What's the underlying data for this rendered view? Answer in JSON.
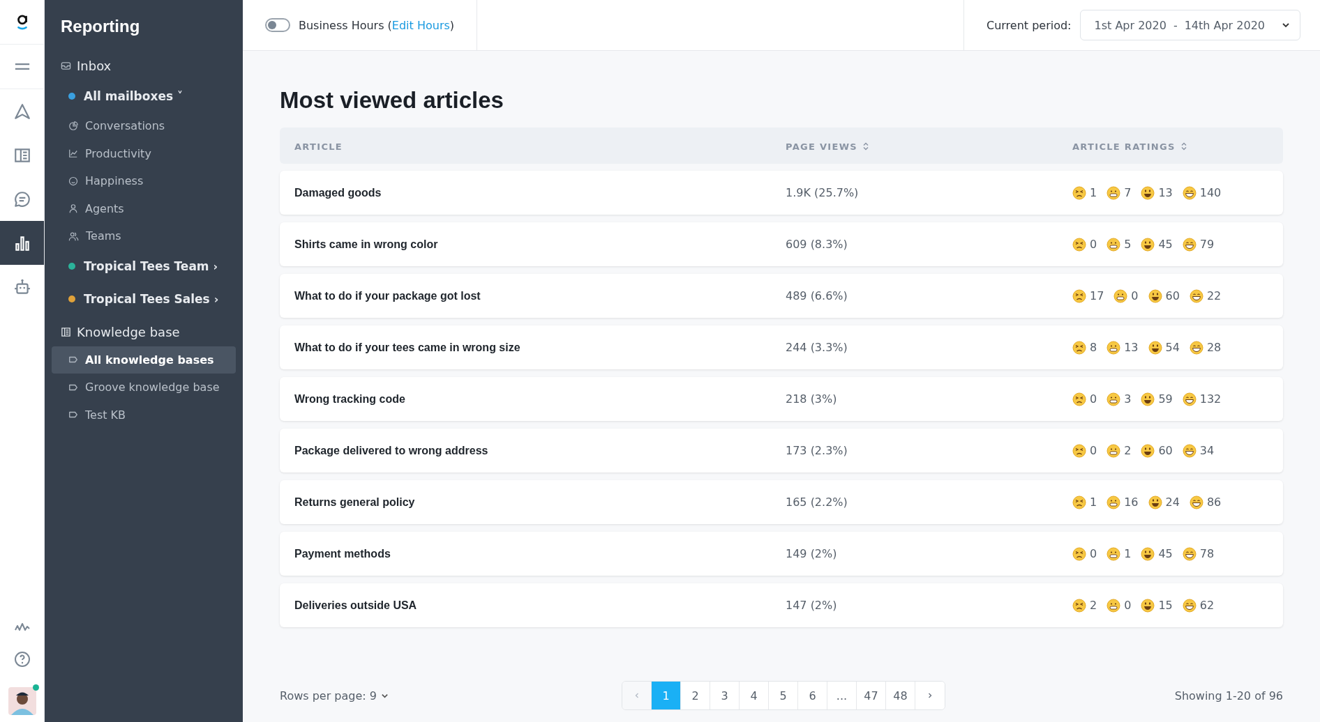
{
  "rail": {
    "items": [
      {
        "kind": "menu",
        "selected": false
      },
      {
        "kind": "send",
        "selected": false
      },
      {
        "kind": "book",
        "selected": false
      },
      {
        "kind": "chat",
        "selected": false
      },
      {
        "kind": "chart",
        "selected": true
      },
      {
        "kind": "bot",
        "selected": false
      }
    ],
    "bottom": [
      {
        "kind": "pulse"
      },
      {
        "kind": "help"
      }
    ],
    "avatar_online": true
  },
  "sidebar": {
    "title": "Reporting",
    "sections": [
      {
        "label": "Inbox",
        "kind": "inbox",
        "items": [
          {
            "label": "All mailboxes",
            "kind": "group",
            "color": "#3aa0e0",
            "caret": "˅",
            "selected": false
          },
          {
            "label": "Conversations",
            "kind": "pie",
            "selected": false
          },
          {
            "label": "Productivity",
            "kind": "line",
            "selected": false
          },
          {
            "label": "Happiness",
            "kind": "smile",
            "selected": false
          },
          {
            "label": "Agents",
            "kind": "person",
            "selected": false
          },
          {
            "label": "Teams",
            "kind": "people",
            "selected": false
          },
          {
            "label": "Tropical Tees Team",
            "kind": "group",
            "color": "#2bb39a",
            "caret": "›",
            "selected": false
          },
          {
            "label": "Tropical Tees Sales",
            "kind": "group",
            "color": "#e0a23a",
            "caret": "›",
            "selected": false
          }
        ]
      },
      {
        "label": "Knowledge base",
        "kind": "book",
        "items": [
          {
            "label": "All knowledge bases",
            "kind": "tag",
            "selected": true
          },
          {
            "label": "Groove knowledge base",
            "kind": "tag",
            "selected": false
          },
          {
            "label": "Test KB",
            "kind": "tag",
            "selected": false
          }
        ]
      }
    ]
  },
  "topbar": {
    "business_hours": {
      "label": "Business Hours (",
      "link": "Edit Hours",
      "suffix": ")",
      "on": false
    },
    "period_label": "Current period:",
    "period_start": "1st Apr 2020",
    "period_sep": "-",
    "period_end": "14th Apr 2020"
  },
  "title": "Most viewed articles",
  "table": {
    "columns": [
      {
        "label": "ARTICLE",
        "sortable": false
      },
      {
        "label": "PAGE VIEWS",
        "sortable": true
      },
      {
        "label": "ARTICLE RATINGS",
        "sortable": true
      }
    ],
    "rows": [
      {
        "article": "Damaged goods",
        "views": "1.9K (25.7%)",
        "ratings": [
          {
            "kind": "tired",
            "count": "1"
          },
          {
            "kind": "grimace",
            "count": "7"
          },
          {
            "kind": "smile",
            "count": "13"
          },
          {
            "kind": "grin",
            "count": "140"
          }
        ]
      },
      {
        "article": "Shirts came in wrong color",
        "views": "609 (8.3%)",
        "ratings": [
          {
            "kind": "tired",
            "count": "0"
          },
          {
            "kind": "grimace",
            "count": "5"
          },
          {
            "kind": "smile",
            "count": "45"
          },
          {
            "kind": "grin",
            "count": "79"
          }
        ]
      },
      {
        "article": "What to do if your package got lost",
        "views": "489 (6.6%)",
        "ratings": [
          {
            "kind": "tired",
            "count": "17"
          },
          {
            "kind": "grimace",
            "count": "0"
          },
          {
            "kind": "smile",
            "count": "60"
          },
          {
            "kind": "grin",
            "count": "22"
          }
        ]
      },
      {
        "article": "What to do if your tees came in wrong size",
        "views": "244 (3.3%)",
        "ratings": [
          {
            "kind": "tired",
            "count": "8"
          },
          {
            "kind": "grimace",
            "count": "13"
          },
          {
            "kind": "smile",
            "count": "54"
          },
          {
            "kind": "grin",
            "count": "28"
          }
        ]
      },
      {
        "article": "Wrong tracking code",
        "views": "218 (3%)",
        "ratings": [
          {
            "kind": "tired",
            "count": "0"
          },
          {
            "kind": "grimace",
            "count": "3"
          },
          {
            "kind": "smile",
            "count": "59"
          },
          {
            "kind": "grin",
            "count": "132"
          }
        ]
      },
      {
        "article": "Package delivered to wrong address",
        "views": "173 (2.3%)",
        "ratings": [
          {
            "kind": "tired",
            "count": "0"
          },
          {
            "kind": "grimace",
            "count": "2"
          },
          {
            "kind": "smile",
            "count": "60"
          },
          {
            "kind": "grin",
            "count": "34"
          }
        ]
      },
      {
        "article": "Returns general policy",
        "views": "165 (2.2%)",
        "ratings": [
          {
            "kind": "tired",
            "count": "1"
          },
          {
            "kind": "grimace",
            "count": "16"
          },
          {
            "kind": "smile",
            "count": "24"
          },
          {
            "kind": "grin",
            "count": "86"
          }
        ]
      },
      {
        "article": "Payment methods",
        "views": "149 (2%)",
        "ratings": [
          {
            "kind": "tired",
            "count": "0"
          },
          {
            "kind": "grimace",
            "count": "1"
          },
          {
            "kind": "smile",
            "count": "45"
          },
          {
            "kind": "grin",
            "count": "78"
          }
        ]
      },
      {
        "article": "Deliveries outside USA",
        "views": "147 (2%)",
        "ratings": [
          {
            "kind": "tired",
            "count": "2"
          },
          {
            "kind": "grimace",
            "count": "0"
          },
          {
            "kind": "smile",
            "count": "15"
          },
          {
            "kind": "grin",
            "count": "62"
          }
        ]
      }
    ]
  },
  "footer": {
    "rows_per_page": "Rows per page: 9",
    "pages": [
      {
        "label": "1",
        "selected": true
      },
      {
        "label": "2",
        "selected": false
      },
      {
        "label": "3",
        "selected": false
      },
      {
        "label": "4",
        "selected": false
      },
      {
        "label": "5",
        "selected": false
      },
      {
        "label": "6",
        "selected": false
      },
      {
        "label": "...",
        "selected": false
      },
      {
        "label": "47",
        "selected": false
      },
      {
        "label": "48",
        "selected": false
      }
    ],
    "showing": "Showing 1-20 of 96"
  }
}
